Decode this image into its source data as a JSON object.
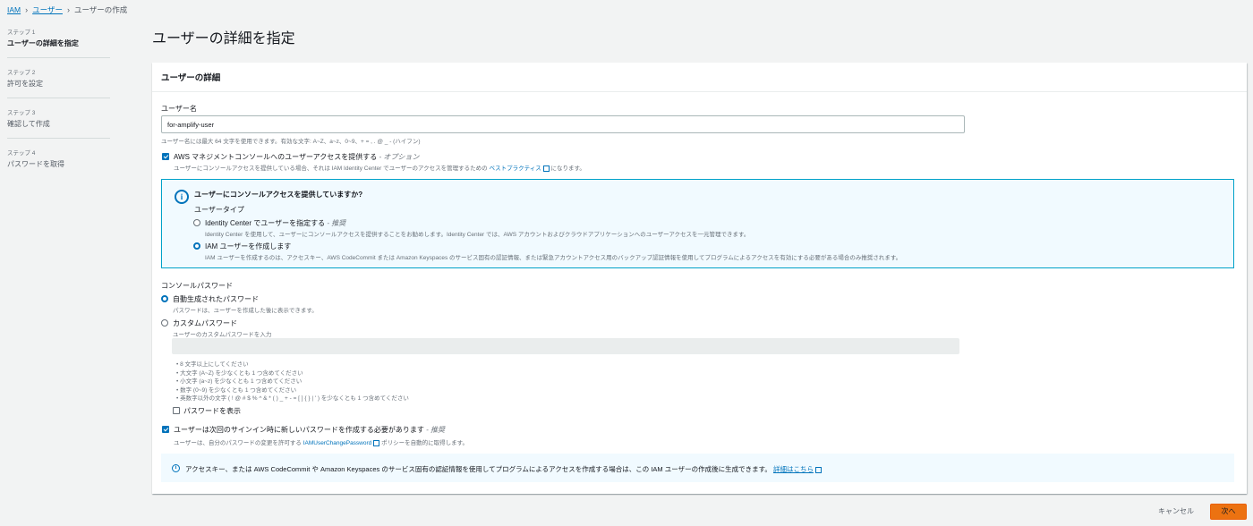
{
  "breadcrumb": {
    "iam": "IAM",
    "users": "ユーザー",
    "current": "ユーザーの作成"
  },
  "steps": [
    {
      "num": "ステップ 1",
      "title": "ユーザーの詳細を指定"
    },
    {
      "num": "ステップ 2",
      "title": "許可を設定"
    },
    {
      "num": "ステップ 3",
      "title": "確認して作成"
    },
    {
      "num": "ステップ 4",
      "title": "パスワードを取得"
    }
  ],
  "page_title": "ユーザーの詳細を指定",
  "panel": {
    "header": "ユーザーの詳細",
    "username_label": "ユーザー名",
    "username_value": "for-amplify-user",
    "username_desc": "ユーザー名には最大 64 文字を使用できます。有効な文字: A~Z、a~z、0~9、+ = , . @ _ - (ハイフン)",
    "console_access_label": "AWS マネジメントコンソールへのユーザーアクセスを提供する",
    "console_access_opt": "- オプション",
    "console_access_desc_pre": "ユーザーにコンソールアクセスを提供している場合、それは IAM Identity Center でユーザーのアクセスを管理するための",
    "console_access_link": "ベストプラクティス",
    "console_access_desc_post": "になります。",
    "info": {
      "question": "ユーザーにコンソールアクセスを提供していますか?",
      "user_type": "ユーザータイプ",
      "opt1_label": "Identity Center でユーザーを指定する",
      "opt1_tag": "- 推奨",
      "opt1_desc": "Identity Center を使用して、ユーザーにコンソールアクセスを提供することをお勧めします。Identity Center では、AWS アカウントおよびクラウドアプリケーションへのユーザーアクセスを一元管理できます。",
      "opt2_label": "IAM ユーザーを作成します",
      "opt2_desc": "IAM ユーザーを作成するのは、アクセスキー、AWS CodeCommit または Amazon Keyspaces のサービス固有の認証情報、または緊急アカウントアクセス用のバックアップ認証情報を使用してプログラムによるアクセスを有効にする必要がある場合のみ推奨されます。"
    },
    "password": {
      "label": "コンソールパスワード",
      "auto_label": "自動生成されたパスワード",
      "auto_desc": "パスワードは、ユーザーを作成した後に表示できます。",
      "custom_label": "カスタムパスワード",
      "custom_desc": "ユーザーのカスタムパスワードを入力",
      "rules": [
        "8 文字以上にしてください",
        "大文字 (A~Z) を少なくとも 1 つ含めてください",
        "小文字 (a~z) を少なくとも 1 つ含めてください",
        "数字 (0~9) を少なくとも 1 つ含めてください",
        "英数字以外の文字 ( ! @ # $ % ^ & * ( ) _ + - = [ ] { } | ' ) を少なくとも 1 つ含めてください"
      ],
      "show_label": "パスワードを表示"
    },
    "reset": {
      "label": "ユーザーは次回のサインイン時に新しいパスワードを作成する必要があります",
      "tag": "- 推奨",
      "desc_pre": "ユーザーは、自分のパスワードの変更を許可する",
      "desc_link": "IAMUserChangePassword",
      "desc_post": "ポリシーを自動的に取得します。"
    },
    "bottom_info": "アクセスキー、または AWS CodeCommit や Amazon Keyspaces のサービス固有の認証情報を使用してプログラムによるアクセスを作成する場合は、この IAM ユーザーの作成後に生成できます。",
    "bottom_info_link": "詳細はこちら"
  },
  "footer": {
    "cancel": "キャンセル",
    "next": "次へ"
  },
  "colors": {
    "accent": "#0073bb",
    "primary_button": "#ec7211"
  }
}
